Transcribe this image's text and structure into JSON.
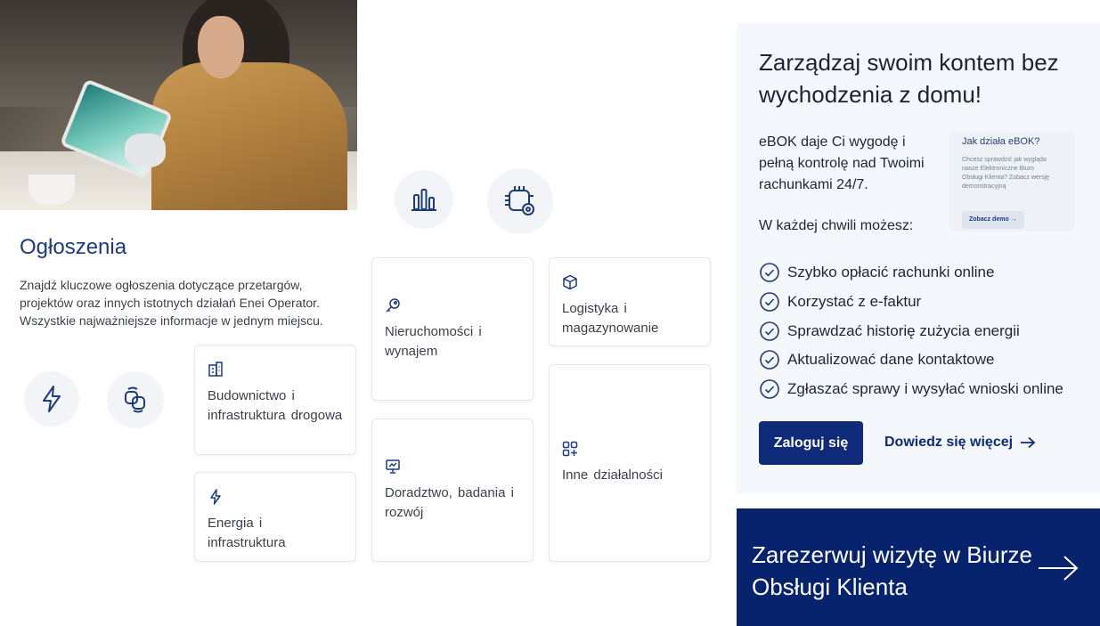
{
  "announcements": {
    "title": "Ogłoszenia",
    "description": "Znajdź kluczowe ogłoszenia dotyczące przetargów, projektów oraz innych istotnych działań Enei Operator. Wszystkie najważniejsze informacje w jednym miejscu.",
    "categories": [
      {
        "label": "Budownictwo i infrastruktura drogowa",
        "icon": "building-icon"
      },
      {
        "label": "Energia i infrastruktura",
        "icon": "lightning-icon"
      },
      {
        "label": "Nieruchomości i wynajem",
        "icon": "key-icon"
      },
      {
        "label": "Doradztwo, badania i rozwój",
        "icon": "presentation-icon"
      },
      {
        "label": "Logistyka i magazynowanie",
        "icon": "box-icon"
      },
      {
        "label": "Inne działalności",
        "icon": "grid-plus-icon"
      }
    ]
  },
  "ebok": {
    "title": "Zarządzaj swoim kontem bez wychodzenia z domu!",
    "intro": "eBOK daje Ci wygodę i pełną kontrolę nad Twoimi rachunkami 24/7.",
    "subtitle": "W każdej chwili możesz:",
    "features": [
      "Szybko opłacić rachunki online",
      "Korzystać z e-faktur",
      "Sprawdzać historię zużycia energii",
      "Aktualizować dane kontaktowe",
      "Zgłaszać sprawy i wysyłać wnioski online"
    ],
    "login_label": "Zaloguj się",
    "more_label": "Dowiedz się więcej",
    "demo": {
      "title": "Jak działa eBOK?",
      "description": "Chcesz sprawdzić jak wygląda nasze Elektroniczne Biuro Obsługi Klienta? Zobacz wersję demonstracyjną",
      "button": "Zobacz demo"
    }
  },
  "booking": {
    "label": "Zarezerwuj wizytę w Biurze Obsługi Klienta"
  },
  "colors": {
    "navy": "#0e2a78",
    "booking_bg": "#08236e",
    "panel_bg": "#f4f7fc",
    "title_blue": "#1c3b78"
  }
}
